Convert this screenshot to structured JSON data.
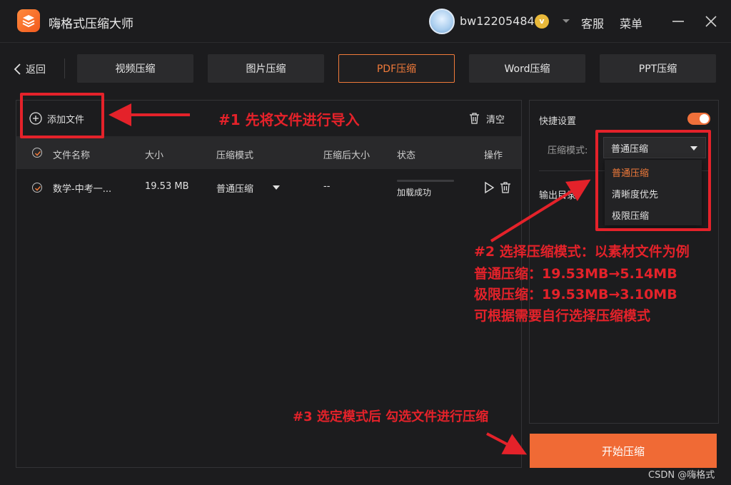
{
  "app": {
    "title": "嗨格式压缩大师"
  },
  "user": {
    "name": "bw12205484",
    "vip": "v"
  },
  "titlebar": {
    "service": "客服",
    "menu": "菜单"
  },
  "nav": {
    "back": "返回",
    "tabs": [
      {
        "label": "视频压缩",
        "active": false
      },
      {
        "label": "图片压缩",
        "active": false
      },
      {
        "label": "PDF压缩",
        "active": true
      },
      {
        "label": "Word压缩",
        "active": false
      },
      {
        "label": "PPT压缩",
        "active": false
      }
    ]
  },
  "filelist": {
    "add_label": "添加文件",
    "clear_label": "清空",
    "columns": [
      "文件名称",
      "大小",
      "压缩模式",
      "压缩后大小",
      "状态",
      "操作"
    ],
    "rows": [
      {
        "name": "数学-中考一...",
        "size": "19.53 MB",
        "mode": "普通压缩",
        "compressed_size": "--",
        "status": "加载成功",
        "progress": 1.0
      }
    ]
  },
  "settings": {
    "quick_label": "快捷设置",
    "quick_enabled": true,
    "mode_label": "压缩模式:",
    "mode_value": "普通压缩",
    "output_label": "输出目录:",
    "mode_options": [
      "普通压缩",
      "清晰度优先",
      "极限压缩"
    ]
  },
  "start_button": "开始压缩",
  "annotations": {
    "step1": "#1 先将文件进行导入",
    "step2_lines": [
      "#2 选择压缩模式：以素材文件为例",
      "普通压缩：19.53MB→5.14MB",
      "极限压缩：19.53MB→3.10MB",
      "可根据需要自行选择压缩模式"
    ],
    "step3": "#3 选定模式后 勾选文件进行压缩",
    "color": "#e4222a"
  },
  "watermark": "CSDN @嗨格式",
  "colors": {
    "accent": "#f06a35",
    "background": "#1c1c1e"
  }
}
